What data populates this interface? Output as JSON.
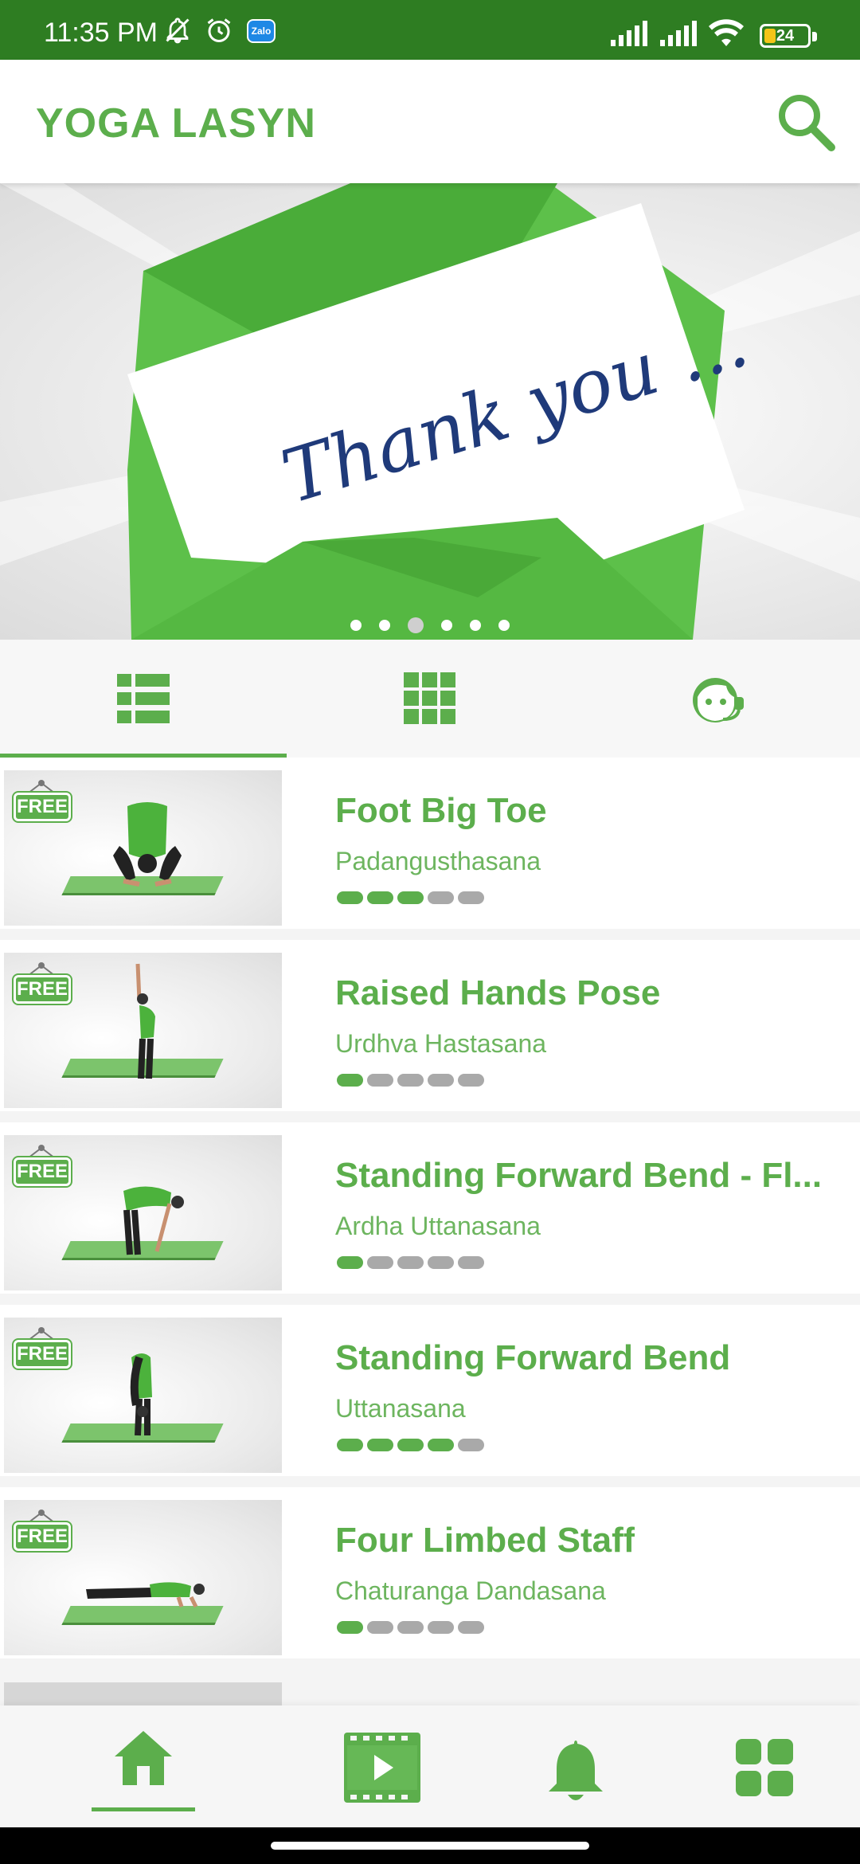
{
  "status_bar": {
    "time": "11:35 PM",
    "battery": "24",
    "icons": [
      "mute-bell-icon",
      "alarm-icon",
      "zalo-icon",
      "signal-icon",
      "signal-icon",
      "wifi-icon",
      "battery-icon"
    ],
    "zalo_label": "Zalo"
  },
  "app_bar": {
    "title": "YOGA LASYN",
    "search_icon": "search-icon"
  },
  "banner": {
    "caption": "Thank you ...",
    "slide_count": 6,
    "active_slide": 3
  },
  "tabs": [
    {
      "icon": "list-view-icon",
      "active": true
    },
    {
      "icon": "grid-view-icon",
      "active": false
    },
    {
      "icon": "support-agent-icon",
      "active": false
    }
  ],
  "free_badge": "FREE",
  "poses": [
    {
      "name": "Foot Big Toe",
      "sanskrit": "Padangusthasana",
      "level": 3
    },
    {
      "name": "Raised Hands Pose",
      "sanskrit": "Urdhva Hastasana",
      "level": 1
    },
    {
      "name": "Standing Forward Bend - Fl...",
      "sanskrit": "Ardha Uttanasana",
      "level": 1
    },
    {
      "name": "Standing Forward Bend",
      "sanskrit": "Uttanasana",
      "level": 4
    },
    {
      "name": "Four Limbed Staff",
      "sanskrit": "Chaturanga Dandasana",
      "level": 1
    }
  ],
  "level_max": 5,
  "bottom_nav": [
    {
      "icon": "home-icon",
      "active": true
    },
    {
      "icon": "video-icon",
      "active": false
    },
    {
      "icon": "bell-icon",
      "active": false
    },
    {
      "icon": "apps-grid-icon",
      "active": false
    }
  ],
  "colors": {
    "accent": "#5cae4c",
    "status_bar": "#2e7d22",
    "level_off": "#a9a9a9"
  }
}
